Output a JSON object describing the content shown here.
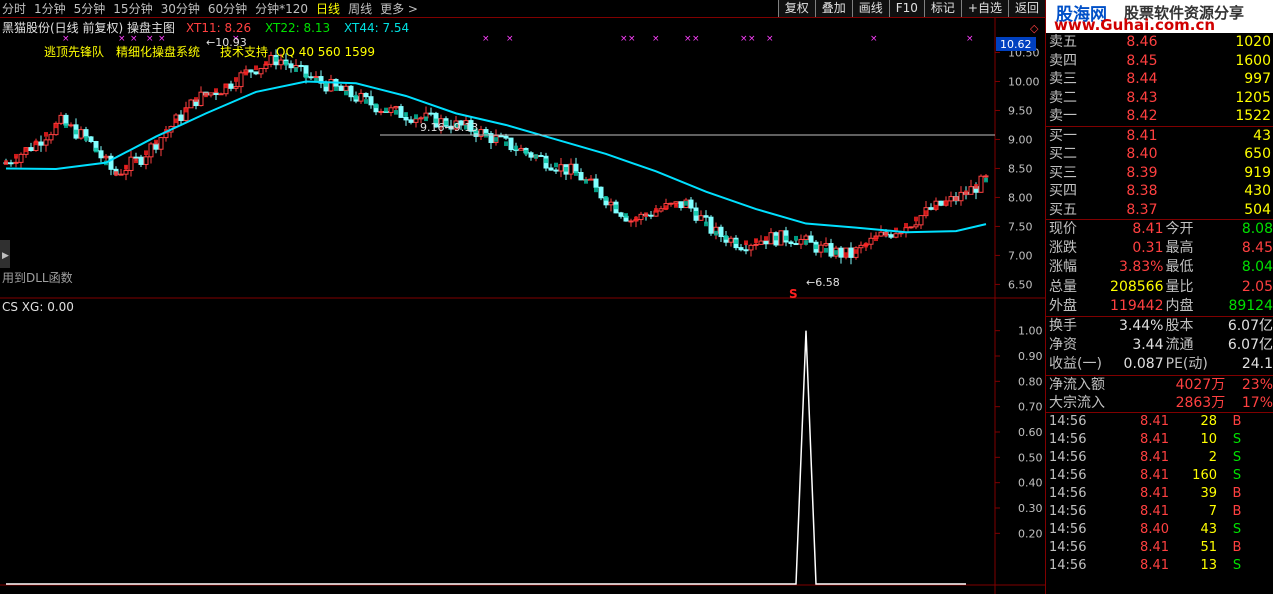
{
  "topbar": {
    "periods": [
      "分时",
      "1分钟",
      "5分钟",
      "15分钟",
      "30分钟",
      "60分钟",
      "分钟*120",
      "日线",
      "周线"
    ],
    "active_period": "日线",
    "more_label": "更多 >",
    "buttons": [
      "复权",
      "叠加",
      "画线",
      "F10",
      "标记",
      "+自选",
      "返回"
    ]
  },
  "main_chart": {
    "title": "黑猫股份(日线 前复权) 操盘主图",
    "indicators": [
      {
        "label": "XT11: 8.26",
        "color": "#ff4040"
      },
      {
        "label": "XT22: 8.13",
        "color": "#00e000"
      },
      {
        "label": "XT44: 7.54",
        "color": "#00e0e0"
      }
    ],
    "ad_texts": [
      "逃顶先锋队",
      "精细化操盘系统",
      "技术支持",
      "QQ 40 560 1599"
    ],
    "dll_label": "用到DLL函数",
    "current_price_tag": "10.62",
    "annotation_hline": "9.16→9.13",
    "annotation_low": "←6.58",
    "annotation_high": "←10.93",
    "signal_label": "S",
    "yaxis_labels": [
      "10.50",
      "10.00",
      "9.50",
      "9.00",
      "8.50",
      "8.00",
      "7.50",
      "7.00",
      "6.50"
    ]
  },
  "sub_chart": {
    "title": "CS XG: 0.00",
    "yaxis_labels": [
      "1.00",
      "0.90",
      "0.80",
      "0.70",
      "0.60",
      "0.50",
      "0.40",
      "0.30",
      "0.20"
    ]
  },
  "chart_data": {
    "type": "line",
    "series": [
      {
        "name": "XT44",
        "x": [
          0,
          10,
          20,
          30,
          40,
          50,
          60,
          70,
          80,
          90,
          100,
          110,
          120,
          130,
          140,
          150,
          160,
          170,
          180,
          190,
          196
        ],
        "y": [
          8.5,
          8.49,
          8.6,
          9.05,
          9.45,
          9.82,
          10.0,
          9.97,
          9.75,
          9.45,
          9.25,
          9.0,
          8.75,
          8.45,
          8.1,
          7.8,
          7.55,
          7.48,
          7.4,
          7.42,
          7.54
        ]
      },
      {
        "name": "CS XG",
        "x": [
          0,
          158,
          160,
          162,
          192
        ],
        "y": [
          0,
          0,
          1.0,
          0,
          0
        ]
      }
    ],
    "ylim_main": [
      6.3,
      10.75
    ],
    "ylim_sub": [
      0,
      1.05
    ],
    "ylabel": ""
  },
  "right_panel": {
    "banner_site": "股海网",
    "banner_slogan": "股票软件资源分享",
    "banner_url": "www.Guhai.com.cn",
    "asks": [
      {
        "label": "卖五",
        "price": "8.46",
        "vol": "1020"
      },
      {
        "label": "卖四",
        "price": "8.45",
        "vol": "1600"
      },
      {
        "label": "卖三",
        "price": "8.44",
        "vol": "997"
      },
      {
        "label": "卖二",
        "price": "8.43",
        "vol": "1205"
      },
      {
        "label": "卖一",
        "price": "8.42",
        "vol": "1522"
      }
    ],
    "bids": [
      {
        "label": "买一",
        "price": "8.41",
        "vol": "43"
      },
      {
        "label": "买二",
        "price": "8.40",
        "vol": "650"
      },
      {
        "label": "买三",
        "price": "8.39",
        "vol": "919"
      },
      {
        "label": "买四",
        "price": "8.38",
        "vol": "430"
      },
      {
        "label": "买五",
        "price": "8.37",
        "vol": "504"
      }
    ],
    "quote": [
      {
        "l1": "现价",
        "v1": "8.41",
        "c1": "red",
        "l2": "今开",
        "v2": "8.08",
        "c2": "green"
      },
      {
        "l1": "涨跌",
        "v1": "0.31",
        "c1": "red",
        "l2": "最高",
        "v2": "8.45",
        "c2": "red"
      },
      {
        "l1": "涨幅",
        "v1": "3.83%",
        "c1": "red",
        "l2": "最低",
        "v2": "8.04",
        "c2": "green"
      },
      {
        "l1": "总量",
        "v1": "208566",
        "c1": "yellow",
        "l2": "量比",
        "v2": "2.05",
        "c2": "red"
      },
      {
        "l1": "外盘",
        "v1": "119442",
        "c1": "red",
        "l2": "内盘",
        "v2": "89124",
        "c2": "green"
      }
    ],
    "quote2": [
      {
        "l1": "换手",
        "v1": "3.44%",
        "c1": "white",
        "l2": "股本",
        "v2": "6.07亿",
        "c2": "white"
      },
      {
        "l1": "净资",
        "v1": "3.44",
        "c1": "white",
        "l2": "流通",
        "v2": "6.07亿",
        "c2": "white"
      },
      {
        "l1": "收益(一)",
        "v1": "0.087",
        "c1": "white",
        "l2": "PE(动)",
        "v2": "24.1",
        "c2": "white"
      }
    ],
    "flow": [
      {
        "label": "净流入额",
        "value": "4027万",
        "pct": "23%"
      },
      {
        "label": "大宗流入",
        "value": "2863万",
        "pct": "17%"
      }
    ],
    "ticks": [
      {
        "time": "14:56",
        "price": "8.41",
        "vol": "28",
        "bs": "B"
      },
      {
        "time": "14:56",
        "price": "8.41",
        "vol": "10",
        "bs": "S"
      },
      {
        "time": "14:56",
        "price": "8.41",
        "vol": "2",
        "bs": "S"
      },
      {
        "time": "14:56",
        "price": "8.41",
        "vol": "160",
        "bs": "S"
      },
      {
        "time": "14:56",
        "price": "8.41",
        "vol": "39",
        "bs": "B"
      },
      {
        "time": "14:56",
        "price": "8.41",
        "vol": "7",
        "bs": "B"
      },
      {
        "time": "14:56",
        "price": "8.40",
        "vol": "43",
        "bs": "S"
      },
      {
        "time": "14:56",
        "price": "8.41",
        "vol": "51",
        "bs": "B"
      },
      {
        "time": "14:56",
        "price": "8.41",
        "vol": "13",
        "bs": "S"
      }
    ]
  }
}
